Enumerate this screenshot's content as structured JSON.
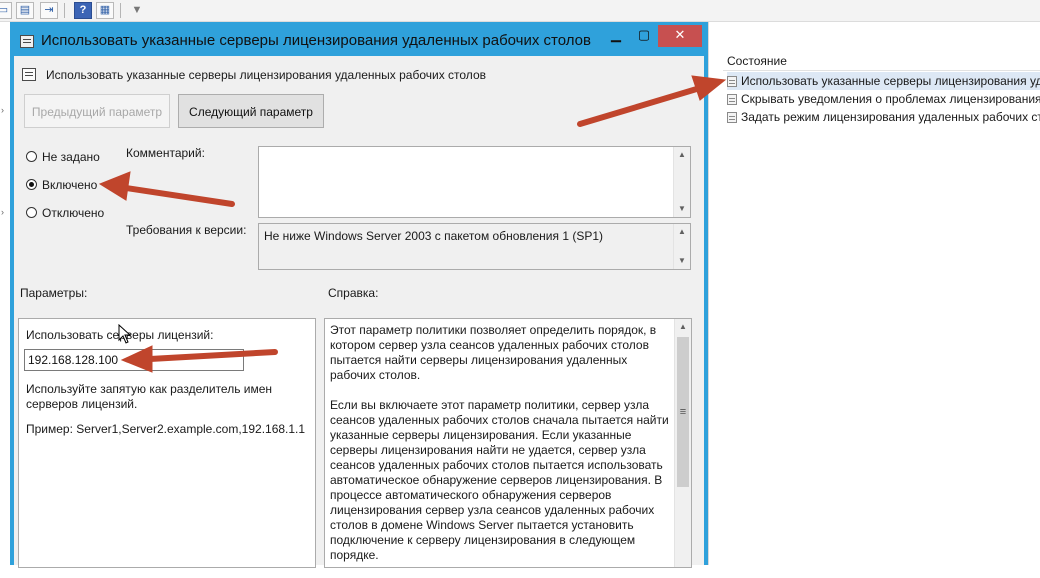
{
  "dialog": {
    "title": "Использовать указанные серверы лицензирования удаленных рабочих столов",
    "subtitle": "Использовать указанные серверы лицензирования удаленных рабочих столов",
    "prev_button": "Предыдущий параметр",
    "next_button": "Следующий параметр",
    "radio": {
      "not_configured": "Не задано",
      "enabled": "Включено",
      "disabled": "Отключено",
      "selected": "enabled"
    },
    "comment_label": "Комментарий:",
    "comment_value": "",
    "version_label": "Требования к версии:",
    "version_value": "Не ниже Windows Server 2003 с пакетом обновления 1 (SP1)",
    "params_label": "Параметры:",
    "help_label": "Справка:",
    "params": {
      "servers_label": "Использовать серверы лицензий:",
      "servers_value": "192.168.128.100",
      "hint": "Используйте запятую как разделитель имен серверов лицензий.",
      "example": "Пример: Server1,Server2.example.com,192.168.1.1"
    },
    "help": {
      "p1": "Этот параметр политики позволяет определить порядок, в котором сервер узла сеансов удаленных рабочих столов пытается найти серверы лицензирования удаленных рабочих столов.",
      "p2": "Если вы включаете этот параметр политики, сервер узла сеансов удаленных рабочих столов сначала пытается найти указанные серверы лицензирования. Если указанные серверы лицензирования найти не удается, сервер узла сеансов удаленных рабочих столов пытается использовать автоматическое обнаружение серверов лицензирования. В процессе автоматического обнаружения серверов лицензирования сервер узла сеансов удаленных рабочих столов в домене Windows Server пытается установить подключение к серверу лицензирования в следующем порядке."
    }
  },
  "right_pane": {
    "header": "Состояние",
    "items": [
      "Использовать указанные серверы лицензирования удаленных рабочих столов",
      "Скрывать уведомления о проблемах лицензирования удаленных рабочих столов",
      "Задать режим лицензирования удаленных рабочих столов"
    ]
  },
  "annotation_color": "#c0452c",
  "accent_color": "#2fa1db"
}
